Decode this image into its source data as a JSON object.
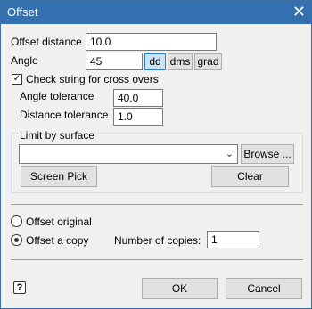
{
  "window": {
    "title": "Offset",
    "close_glyph": "✕"
  },
  "offset_distance": {
    "label": "Offset distance",
    "value": "10.0"
  },
  "angle": {
    "label": "Angle",
    "value": "45",
    "units": [
      "dd",
      "dms",
      "grad"
    ],
    "selected_unit": "dd"
  },
  "crossovers": {
    "label": "Check string for cross overs",
    "checked": true
  },
  "angle_tolerance": {
    "label": "Angle tolerance",
    "value": "40.0"
  },
  "distance_tolerance": {
    "label": "Distance tolerance",
    "value": "1.0"
  },
  "limit_by_surface": {
    "label": "Limit by surface",
    "value": "",
    "browse_label": "Browse ...",
    "screen_pick_label": "Screen Pick",
    "clear_label": "Clear"
  },
  "mode": {
    "offset_original_label": "Offset original",
    "offset_copy_label": "Offset a copy",
    "selected": "offset_copy"
  },
  "copies": {
    "label": "Number of copies:",
    "value": "1"
  },
  "footer": {
    "help_glyph": "?",
    "ok_label": "OK",
    "cancel_label": "Cancel"
  }
}
